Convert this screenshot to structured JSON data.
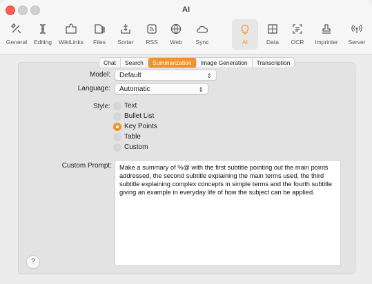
{
  "window": {
    "title": "AI"
  },
  "toolbar": {
    "items": [
      {
        "label": "General",
        "icon": "tools-icon"
      },
      {
        "label": "Editing",
        "icon": "text-cursor-icon"
      },
      {
        "label": "WikiLinks",
        "icon": "puzzle-icon"
      },
      {
        "label": "Files",
        "icon": "file-stack-icon"
      },
      {
        "label": "Sorter",
        "icon": "tray-sort-icon"
      },
      {
        "label": "RSS",
        "icon": "rss-icon"
      },
      {
        "label": "Web",
        "icon": "globe-icon"
      },
      {
        "label": "Sync",
        "icon": "cloud-icon"
      },
      {
        "label": "AI",
        "icon": "lightbulb-icon"
      },
      {
        "label": "Data",
        "icon": "table-icon"
      },
      {
        "label": "OCR",
        "icon": "scan-text-icon"
      },
      {
        "label": "Imprinter",
        "icon": "stamp-icon"
      },
      {
        "label": "Server",
        "icon": "broadcast-icon"
      }
    ],
    "active": "AI",
    "accent": "#f0932c"
  },
  "tabs": [
    "Chat",
    "Search",
    "Summarization",
    "Image Generation",
    "Transcription"
  ],
  "active_tab": "Summarization",
  "form": {
    "model_label": "Model:",
    "model_value": "Default",
    "language_label": "Language:",
    "language_value": "Automatic",
    "style_label": "Style:",
    "style_options": [
      "Text",
      "Bullet List",
      "Key Points",
      "Table",
      "Custom"
    ],
    "style_selected": "Key Points",
    "prompt_label": "Custom Prompt:",
    "prompt_value": "Make a summary of %@ with the first subtitle pointing out the main points addressed, the second subtitle explaining the main terms used, the third subtitle explaining complex concepts in simple terms and the fourth subtitle giving an example in everyday life of how the subject can be applied."
  },
  "help_label": "?"
}
